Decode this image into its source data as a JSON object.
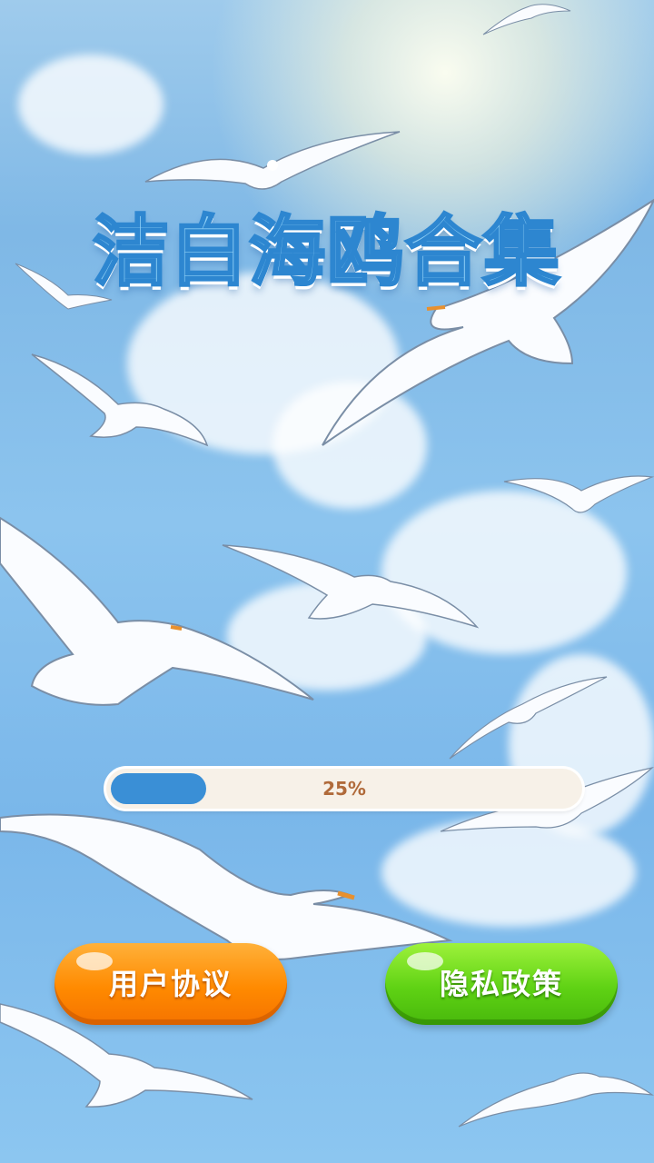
{
  "title": "洁白海鸥合集",
  "progress": {
    "value": 0.25,
    "label": "25%"
  },
  "buttons": {
    "user_agreement": "用户协议",
    "privacy_policy": "隐私政策"
  },
  "colors": {
    "progress_fill": "#3a8fd6",
    "agreement_button": "#ff8a00",
    "privacy_button": "#5fd214",
    "title_stroke": "#2d86d0"
  }
}
